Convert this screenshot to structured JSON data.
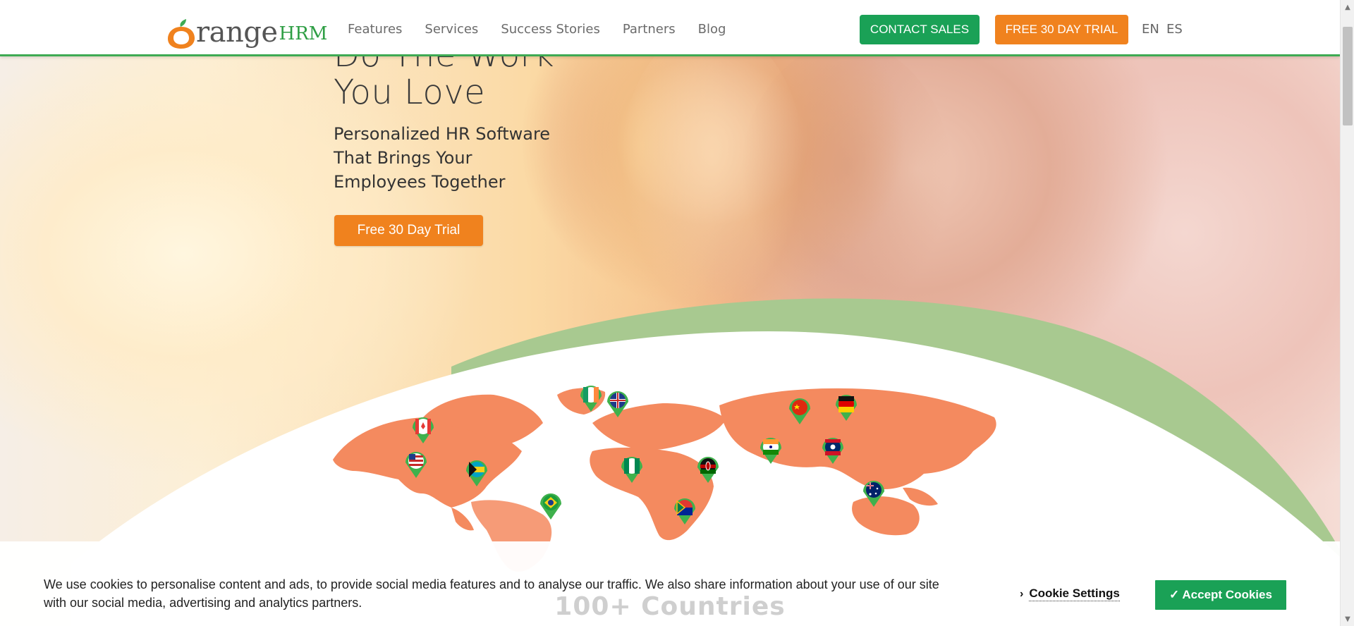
{
  "header": {
    "logo": {
      "word": "range",
      "accent": "HRM"
    },
    "nav": [
      "Features",
      "Services",
      "Success Stories",
      "Partners",
      "Blog"
    ],
    "contact_label": "CONTACT SALES",
    "trial_label": "FREE 30 DAY TRIAL",
    "languages": [
      "EN",
      "ES"
    ]
  },
  "hero": {
    "title_line1": "Do The Work",
    "title_line2": "You Love",
    "subtitle_line1": "Personalized HR Software",
    "subtitle_line2": "That Brings Your",
    "subtitle_line3": "Employees Together",
    "cta_label": "Free 30 Day Trial"
  },
  "map": {
    "markers": [
      "canada-flag",
      "united-states-flag",
      "bahamas-flag",
      "brazil-flag",
      "ireland-flag",
      "united-kingdom-flag",
      "nigeria-flag",
      "kenya-flag",
      "south-africa-flag",
      "india-flag",
      "china-flag",
      "germany-flag",
      "laos-flag",
      "australia-flag"
    ]
  },
  "section": {
    "countries_label": "100+ Countries"
  },
  "cookie": {
    "text": "We use cookies to personalise content and ads, to provide social media features and to analyse our traffic. We also share information about your use of our site with our social media, advertising and analytics partners.",
    "settings_label": "Cookie Settings",
    "accept_label": "✓ Accept Cookies"
  },
  "colors": {
    "brand_green": "#1aa156",
    "brand_orange": "#f0821e",
    "curve_green": "#a8c990",
    "map_orange": "#f48a5f"
  }
}
